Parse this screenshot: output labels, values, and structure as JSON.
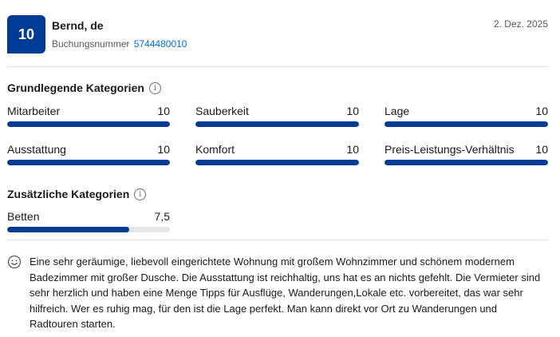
{
  "review": {
    "score": "10",
    "reviewer_name": "Bernd, de",
    "booking_label": "Buchungsnummer",
    "booking_number": "5744480010",
    "date": "2. Dez. 2025"
  },
  "basic_categories": {
    "heading": "Grundlegende Kategorien",
    "items": [
      {
        "label": "Mitarbeiter",
        "value": "10",
        "fraction": 1.0
      },
      {
        "label": "Sauberkeit",
        "value": "10",
        "fraction": 1.0
      },
      {
        "label": "Lage",
        "value": "10",
        "fraction": 1.0
      },
      {
        "label": "Ausstattung",
        "value": "10",
        "fraction": 1.0
      },
      {
        "label": "Komfort",
        "value": "10",
        "fraction": 1.0
      },
      {
        "label": "Preis-Leistungs-Verhältnis",
        "value": "10",
        "fraction": 1.0
      }
    ]
  },
  "extra_categories": {
    "heading": "Zusätzliche Kategorien",
    "items": [
      {
        "label": "Betten",
        "value": "7,5",
        "fraction": 0.75
      }
    ]
  },
  "review_text": {
    "icon": "smiley-icon",
    "positive": "Eine sehr geräumige, liebevoll eingerichtete Wohnung mit großem Wohnzimmer und schönem modernem Badezimmer mit großer Dusche. Die Ausstattung ist reichhaltig, uns hat es an nichts gefehlt. Die Vermieter sind sehr herzlich und haben eine Menge Tipps für Ausflüge, Wanderungen,Lokale etc. vorbereitet, das war sehr hilfreich. Wer es ruhig mag, für den ist die Lage perfekt. Man kann direkt vor Ort zu Wanderungen und Radtouren starten."
  },
  "colors": {
    "brand": "#003b95",
    "link": "#006ce4",
    "track": "#e6e6e6"
  }
}
